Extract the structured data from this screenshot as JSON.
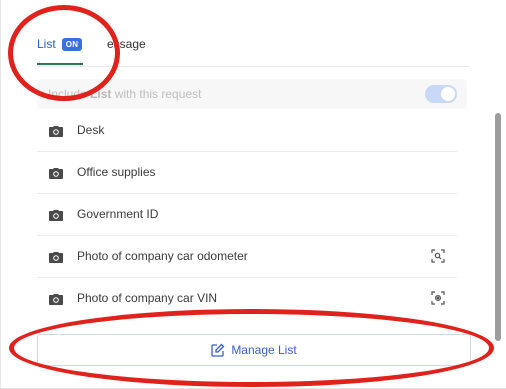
{
  "tabs": {
    "list_label": "List",
    "list_badge": "ON",
    "message_label_visible": "essage"
  },
  "include": {
    "prefix": "Include ",
    "bold": "List",
    "suffix": " with this request",
    "toggle_on": true
  },
  "items": [
    {
      "label": "Desk",
      "icon": "camera-icon",
      "action_icon": ""
    },
    {
      "label": "Office supplies",
      "icon": "camera-icon",
      "action_icon": ""
    },
    {
      "label": "Government ID",
      "icon": "camera-icon",
      "action_icon": ""
    },
    {
      "label": "Photo of company car odometer",
      "icon": "camera-icon",
      "action_icon": "scan-search-icon"
    },
    {
      "label": "Photo of company car VIN",
      "icon": "camera-icon",
      "action_icon": "scan-target-icon"
    }
  ],
  "manage": {
    "label": "Manage List",
    "icon": "edit-icon"
  },
  "colors": {
    "accent": "#3b6fe0",
    "tab_underline": "#2f7a55",
    "annotation": "#e0221d"
  }
}
